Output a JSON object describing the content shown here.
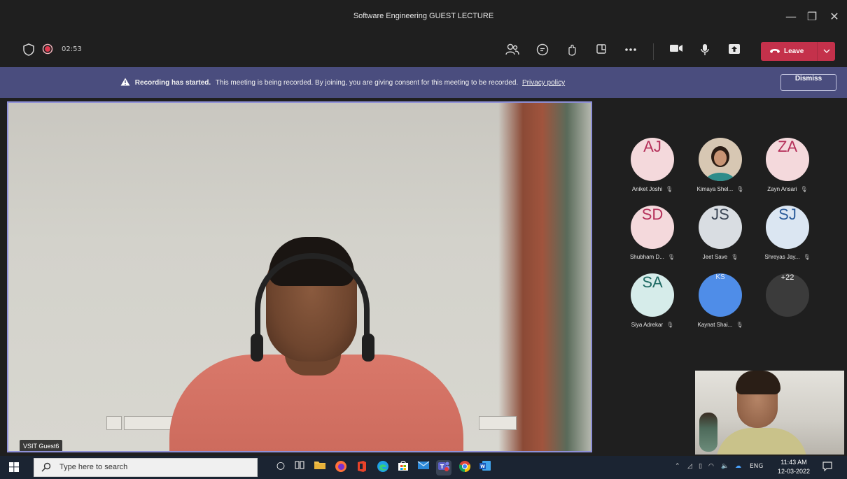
{
  "window": {
    "title": "Software Engineering GUEST LECTURE",
    "minimize_glyph": "—",
    "maximize_glyph": "❐",
    "close_glyph": "✕"
  },
  "toolbar": {
    "timer": "02:53",
    "leave_label": "Leave",
    "icons": [
      "shield-icon",
      "recording-dot-icon",
      "participants-icon",
      "chat-icon",
      "reactions-icon",
      "rooms-icon",
      "more-icon",
      "camera-icon",
      "mic-icon",
      "share-icon",
      "phone-icon",
      "chevron-down-icon"
    ]
  },
  "banner": {
    "heading": "Recording has started.",
    "message": "This meeting is being recorded. By joining, you are giving consent for this meeting to be recorded.",
    "link": "Privacy policy",
    "dismiss_label": "Dismiss"
  },
  "main_video": {
    "name": "VSIT Guest6"
  },
  "participants": [
    {
      "initials": "AJ",
      "name": "Aniket Joshi",
      "bg": "#f4d9dc",
      "fg": "#b5305a"
    },
    {
      "initials": "",
      "name": "Kimaya Shel...",
      "bg": "#d4c4b0",
      "fg": "#333333",
      "photo": true
    },
    {
      "initials": "ZA",
      "name": "Zayn Ansari",
      "bg": "#f4d9dc",
      "fg": "#b5305a"
    },
    {
      "initials": "SD",
      "name": "Shubham D...",
      "bg": "#f4d9dc",
      "fg": "#b5305a"
    },
    {
      "initials": "JS",
      "name": "Jeet Save",
      "bg": "#d9dde2",
      "fg": "#3b4656"
    },
    {
      "initials": "SJ",
      "name": "Shreyas Jay...",
      "bg": "#dbe6f2",
      "fg": "#2b5c9a"
    },
    {
      "initials": "SA",
      "name": "Siya Adrekar",
      "bg": "#d6ecea",
      "fg": "#1e6a63"
    },
    {
      "initials": "KS",
      "name": "Kaynat Shai...",
      "bg": "#4f8de8",
      "fg": "#dfe9fb"
    },
    {
      "initials": "+22",
      "name": "",
      "bg": "#3b3b3b",
      "fg": "#ffffff"
    }
  ],
  "taskbar": {
    "search_placeholder": "Type here to search",
    "lang": "ENG",
    "time": "11:43 AM",
    "date": "12-03-2022"
  }
}
